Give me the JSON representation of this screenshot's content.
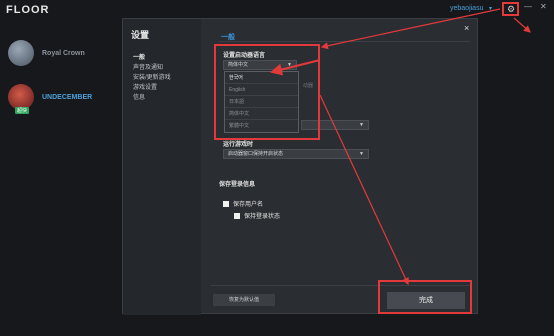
{
  "app": {
    "logo": "FLOOR"
  },
  "topbar": {
    "username": "yebaojiasu",
    "user_chevron": "▾",
    "gear": "⚙",
    "minimize": "—",
    "close": "✕"
  },
  "games": [
    {
      "name": "Royal Crown",
      "color": "#6c7a8c"
    },
    {
      "name": "UNDECEMBER",
      "color": "#7a2c2c",
      "tag": "超快"
    }
  ],
  "settings": {
    "title": "设置",
    "close": "×",
    "nav": [
      "一般",
      "声音及通知",
      "安装/更新游戏",
      "游戏设置",
      "信息"
    ],
    "section_general": "一般",
    "language_label": "设置启动器语言",
    "language_value": "简体中文",
    "caret": "▼",
    "language_options": [
      "한국어",
      "English",
      "日本語",
      "简体中文",
      "繁體中文"
    ],
    "hidden_text": "动器",
    "run_game_label": "运行游戏时",
    "run_game_value": "启动器窗口保持开启状态",
    "login_section": "保存登录信息",
    "save_username": "保存用户名",
    "keep_login": "保持登录状态",
    "reset_button": "恢复为默认值",
    "done_button": "完成"
  },
  "colors": {
    "accent": "#3b95d8",
    "annotation": "#e23a3a"
  }
}
